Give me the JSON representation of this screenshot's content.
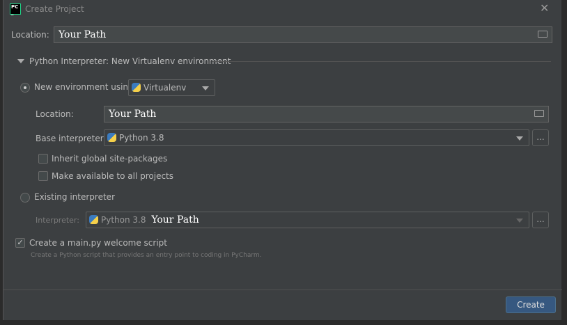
{
  "window": {
    "title": "Create Project",
    "logo": "PC"
  },
  "location": {
    "label": "Location:",
    "value": "Your Path"
  },
  "interpreter_section": {
    "title": "Python Interpreter: New Virtualenv environment"
  },
  "new_env": {
    "label": "New environment using",
    "tool": "Virtualenv",
    "location_label": "Location:",
    "location_value": "Your Path",
    "base_label": "Base interpreter:",
    "base_value": "Python 3.8",
    "inherit_label": "Inherit global site-packages",
    "available_label": "Make available to all projects"
  },
  "existing": {
    "label": "Existing interpreter",
    "interp_label": "Interpreter:",
    "interp_version": "Python 3.8",
    "interp_path": "Your Path"
  },
  "welcome": {
    "label": "Create a main.py welcome script",
    "hint": "Create a Python script that provides an entry point to coding in PyCharm."
  },
  "ellipsis": "...",
  "create_label": "Create",
  "colors": {
    "dialog": "#3c3f41",
    "button": "#365880"
  }
}
